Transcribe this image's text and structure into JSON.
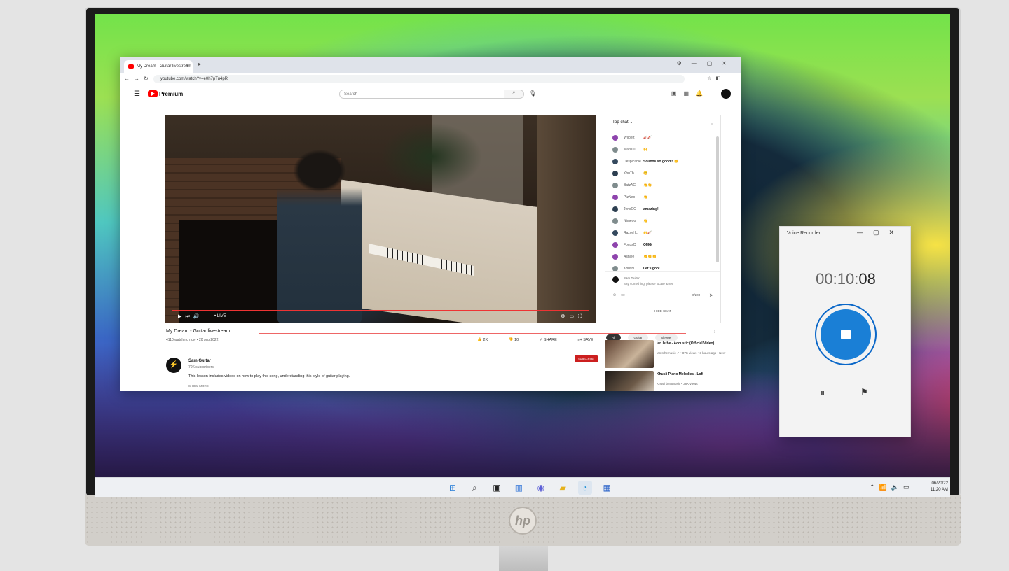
{
  "browser": {
    "tab_title": "My Dream - Guitar livestream",
    "new_tab_icon": "▸",
    "url": "youtube.com/watch?v=e0h7pTu4pR"
  },
  "youtube": {
    "search_placeholder": "Search",
    "logo_text": "Premium"
  },
  "video": {
    "live_label": "• LIVE",
    "title": "My Dream - Guitar livestream",
    "stats": "4110 watching now • 20 sep 2022",
    "likes": "2K",
    "dislikes": "10",
    "share": "SHARE",
    "save": "SAVE"
  },
  "channel": {
    "name": "Sam Guitar",
    "subscribers": "70K subscribers",
    "subscribe_label": "SUBSCRIBE",
    "description": "This lesson includes videos on how to play this song, understanding this style of guitar playing.",
    "show_more": "SHOW MORE"
  },
  "chat": {
    "header": "Top chat",
    "messages": [
      {
        "user": "Wilbert",
        "text": "🎸🎸",
        "color": "#8e44ad"
      },
      {
        "user": "Matsu0",
        "text": "🙌",
        "color": "#7f8c8d"
      },
      {
        "user": "Despicable",
        "text": "Sounds so good!! 👏",
        "color": "#34495e"
      },
      {
        "user": "KhuTh",
        "text": "😊",
        "color": "#2c3e50"
      },
      {
        "user": "BatzAC",
        "text": "👏👏",
        "color": "#7f8c8d"
      },
      {
        "user": "PizNeo",
        "text": "👏",
        "color": "#8e44ad"
      },
      {
        "user": "JensCO",
        "text": "amazing!",
        "color": "#2c3e50"
      },
      {
        "user": "Nimeoo",
        "text": "👏",
        "color": "#7f8c8d"
      },
      {
        "user": "RazorHL",
        "text": "🙌🎸",
        "color": "#34495e"
      },
      {
        "user": "FocusC",
        "text": "OMG",
        "color": "#8e44ad"
      },
      {
        "user": "Ashlee",
        "text": "👏👏👏",
        "color": "#8e44ad"
      },
      {
        "user": "Khushi",
        "text": "Let's goo!",
        "color": "#7f8c8d"
      }
    ],
    "input_name": "Sam Guitar",
    "input_placeholder": "Say something, please locate & set",
    "count": "0/200",
    "hide_label": "HIDE CHAT"
  },
  "chips": [
    "All",
    "Guitar",
    "Sleeper"
  ],
  "recommendations": [
    {
      "title": "Ian Isthe - Acoustic (Official Video)",
      "meta": "IanIsthemusic ✓ • 87K views • 3 hours ago • New"
    },
    {
      "title": "Khusli Piano Melodies - Lofi",
      "meta": "Khusli beatmusic • 38K views"
    }
  ],
  "recorder": {
    "title": "Voice Recorder",
    "time_prefix": "00:10:",
    "time_seconds": "08"
  },
  "clock": {
    "date": "06/20/22",
    "time": "11:20 AM"
  },
  "brand": "hp",
  "colors": {
    "youtube_red": "#ff0000",
    "record_blue": "#1a7fd6",
    "subscribe_red": "#cc1f1f"
  }
}
